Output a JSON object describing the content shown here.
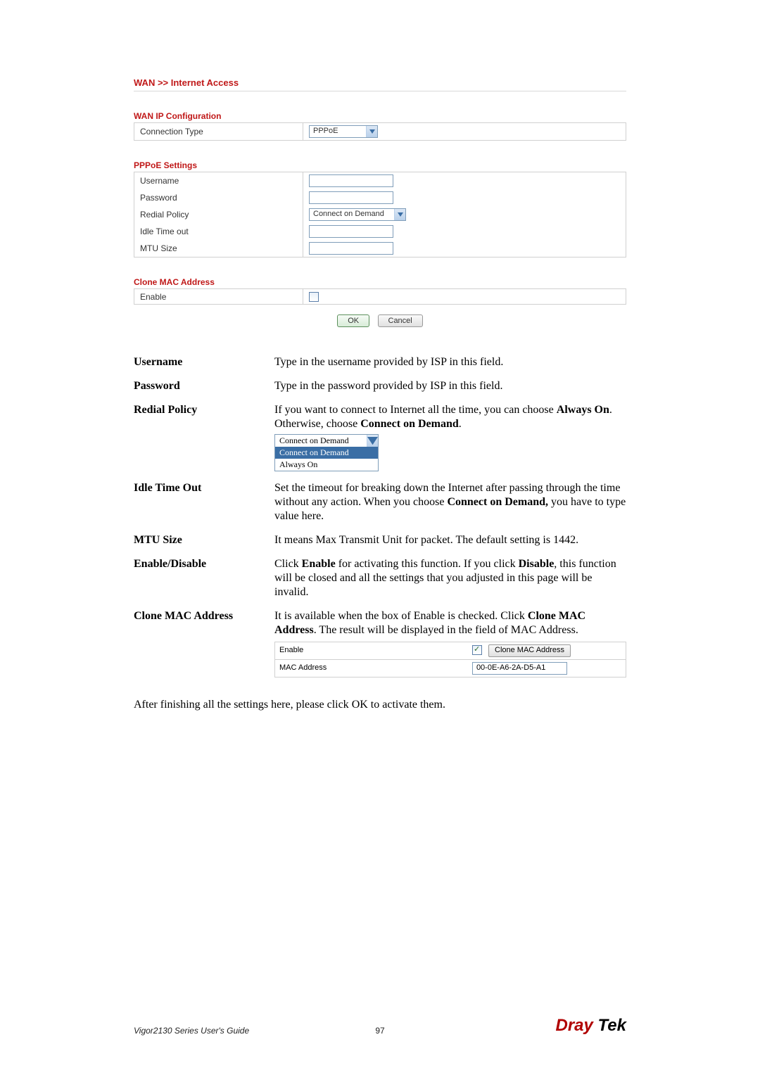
{
  "breadcrumb": "WAN >> Internet Access",
  "section1_title": "WAN IP Configuration",
  "table1": {
    "conn_type_label": "Connection Type",
    "conn_type_value": "PPPoE"
  },
  "section2_title": "PPPoE Settings",
  "table2": {
    "username_label": "Username",
    "password_label": "Password",
    "redial_label": "Redial Policy",
    "redial_value": "Connect on Demand",
    "idle_label": "Idle Time out",
    "mtu_label": "MTU Size"
  },
  "section3_title": "Clone MAC Address",
  "table3": {
    "enable_label": "Enable"
  },
  "buttons": {
    "ok": "OK",
    "cancel": "Cancel"
  },
  "desc": {
    "username": {
      "term": "Username",
      "text": "Type in the username provided by ISP in this field."
    },
    "password": {
      "term": "Password",
      "text": "Type in the password provided by ISP in this field."
    },
    "redial": {
      "term": "Redial Policy",
      "p1a": "If you want to connect to Internet all the time, you can choose ",
      "p1b": "Always On",
      "p1c": ". Otherwise, choose ",
      "p1d": "Connect on Demand",
      "p1e": ".",
      "dd_top": "Connect on Demand",
      "dd_opt1": "Connect on Demand",
      "dd_opt2": "Always On"
    },
    "idle": {
      "term": "Idle Time Out",
      "p1a": "Set the timeout for breaking down the Internet after passing through the time without any action. When you choose ",
      "p1b": "Connect on Demand,",
      "p1c": " you have to type value here."
    },
    "mtu": {
      "term": "MTU Size",
      "text": "It means Max Transmit Unit for packet. The default setting is 1442."
    },
    "enable": {
      "term": "Enable/Disable",
      "p1a": "Click ",
      "p1b": "Enable",
      "p1c": " for activating this function. If you click ",
      "p1d": "Disable",
      "p1e": ", this function will be closed and all the settings that you adjusted in this page will be invalid."
    },
    "clone": {
      "term": "Clone MAC Address",
      "p1a": "It is available when the box of Enable is checked. Click ",
      "p1b": "Clone MAC Address",
      "p1c": ". The result will be displayed in the field of MAC Address.",
      "ex_enable": "Enable",
      "ex_button": "Clone MAC Address",
      "ex_mac_label": "MAC Address",
      "ex_mac_value": "00-0E-A6-2A-D5-A1"
    }
  },
  "closing_a": "After finishing all the settings here, please click ",
  "closing_b": "OK",
  "closing_c": " to activate them.",
  "footer": {
    "guide": "Vigor2130 Series User's Guide",
    "page": "97",
    "logo_dray": "Dray",
    "logo_tek": "Tek"
  }
}
